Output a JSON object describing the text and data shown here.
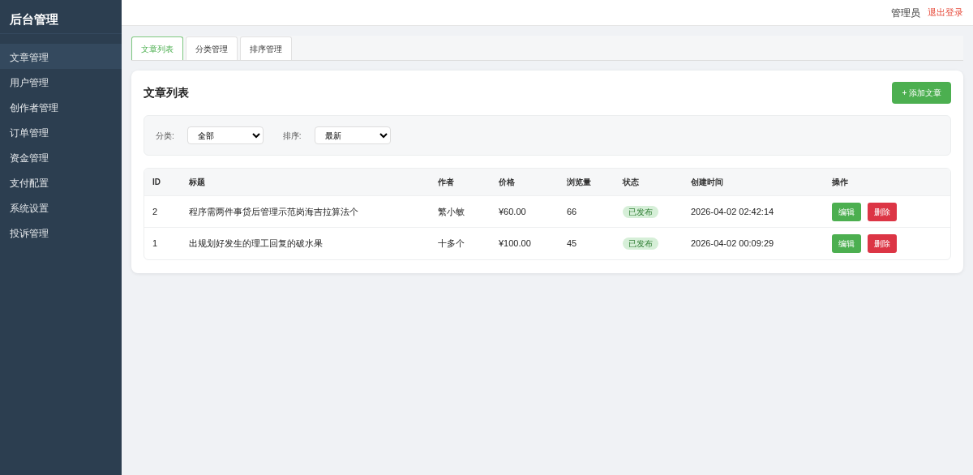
{
  "sidebar": {
    "title": "后台管理",
    "items": [
      {
        "label": "文章管理",
        "selected": true
      },
      {
        "label": "用户管理",
        "selected": false
      },
      {
        "label": "创作者管理",
        "selected": false
      },
      {
        "label": "订单管理",
        "selected": false
      },
      {
        "label": "资金管理",
        "selected": false
      },
      {
        "label": "支付配置",
        "selected": false
      },
      {
        "label": "系统设置",
        "selected": false
      },
      {
        "label": "投诉管理",
        "selected": false
      }
    ]
  },
  "header": {
    "user": "管理员",
    "logout": "退出登录"
  },
  "tabs": [
    {
      "label": "文章列表",
      "selected": true
    },
    {
      "label": "分类管理",
      "selected": false
    },
    {
      "label": "排序管理",
      "selected": false
    }
  ],
  "card": {
    "title": "文章列表",
    "add_button": "+ 添加文章",
    "filters": [
      {
        "label": "分类:",
        "value": "全部"
      },
      {
        "label": "排序:",
        "value": "最新"
      }
    ],
    "table": {
      "columns": [
        "ID",
        "标题",
        "作者",
        "价格",
        "浏览量",
        "状态",
        "创建时间",
        "操作"
      ],
      "rows": [
        {
          "id": "2",
          "title": "程序需两件事贷后管理示范岗海吉拉算法个",
          "author": "繁小敏",
          "price": "¥60.00",
          "views": "66",
          "status": "已发布",
          "created": "2026-04-02 02:42:14",
          "actions": [
            "编辑",
            "删除"
          ]
        },
        {
          "id": "1",
          "title": "出规划好发生的理工回复的破水果",
          "author": "十多个",
          "price": "¥100.00",
          "views": "45",
          "status": "已发布",
          "created": "2026-04-02 00:09:29",
          "actions": [
            "编辑",
            "删除"
          ]
        }
      ]
    }
  }
}
